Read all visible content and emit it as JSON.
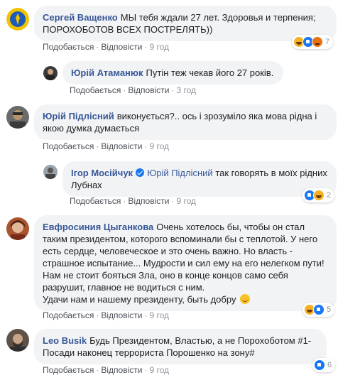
{
  "labels": {
    "like": "Подобається",
    "reply": "Відповісти",
    "dot": "·"
  },
  "comments": [
    {
      "author": "Сергей Ващенко",
      "text": "МЫ тебя ждали 27 лет. Здоровья и терпения; ПОРОХОБОТОВ ВСЕХ ПОСТРЕЛЯТЬ))",
      "time": "9 год",
      "reactions": [
        "haha",
        "like",
        "angry"
      ],
      "reaction_count": "7"
    },
    {
      "author": "Юрій Атаманюк",
      "text": "Путін теж чекав його 27 років.",
      "time": "3 год"
    },
    {
      "author": "Юрій Підлісний",
      "text": "виконується?.. ось і зрозуміло яка мова рідна і якою думка думається",
      "time": "9 год"
    },
    {
      "author": "Ігор Мосійчук",
      "mention": "Юрій Підлісний",
      "text": "так говорять в моїх рідних Лубнах",
      "time": "9 год",
      "reactions": [
        "like",
        "haha"
      ],
      "reaction_count": "2"
    },
    {
      "author": "Евфросиния Цыганкова",
      "text": "Очень хотелось бы, чтобы он стал таким президентом, которого вспоминали бы с теплотой. У него есть сердце, человеческое и это очень важно. Но власть - страшное испытание... Мудрости и сил ему на его нелегком пути! Нам не стоит бояться Зла, оно в конце концов само себя разрушит, главное не водиться с ним.",
      "text2": "Удачи нам и нашему президенту, быть добру",
      "time": "9 год",
      "reactions": [
        "haha",
        "like"
      ],
      "reaction_count": "5"
    },
    {
      "author": "Leo Busik",
      "text": "Будь Президентом, Властью, а не Порохоботом #1- Посади наконец террориста Порошенко на зону#",
      "time": "9 год",
      "reactions": [
        "like"
      ],
      "reaction_count": "6"
    }
  ],
  "colors": {
    "link": "#385898",
    "bubble": "#f2f3f5",
    "meta": "#90949c"
  }
}
